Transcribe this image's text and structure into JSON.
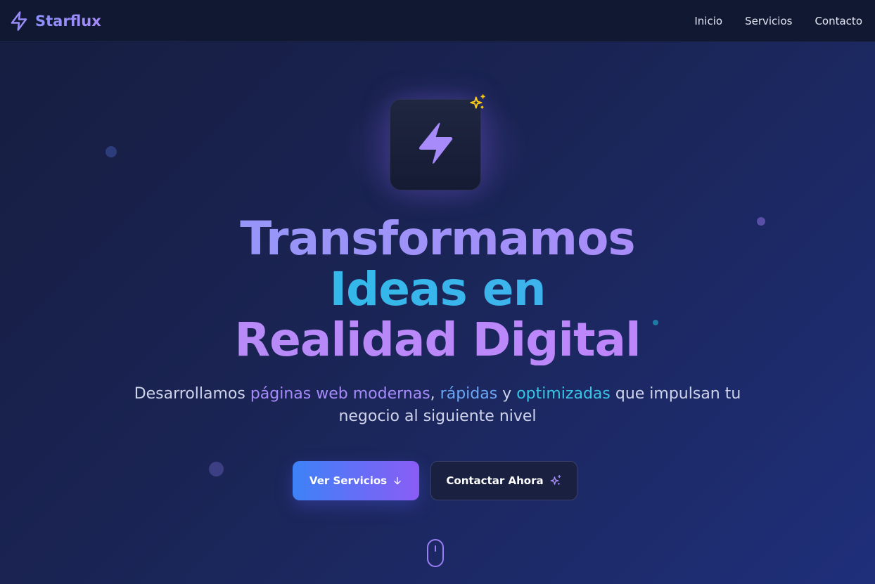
{
  "brand": {
    "name": "Starflux",
    "icon": "lightning-bolt-icon"
  },
  "nav": {
    "items": [
      {
        "label": "Inicio"
      },
      {
        "label": "Servicios"
      },
      {
        "label": "Contacto"
      }
    ]
  },
  "hero": {
    "logo_icon": "lightning-bolt-icon",
    "badge_icon": "sparkles-icon",
    "title_lines": [
      "Transformamos",
      "Ideas en",
      "Realidad Digital"
    ],
    "subtitle": {
      "part1": "Desarrollamos ",
      "highlight1": "páginas web modernas",
      "part2": ", ",
      "highlight2": "rápidas",
      "part3": " y ",
      "highlight3": "optimizadas",
      "part4": " que impulsan tu negocio al siguiente nivel"
    },
    "primary_button": {
      "label": "Ver Servicios",
      "icon": "arrow-down-icon"
    },
    "secondary_button": {
      "label": "Contactar Ahora",
      "icon": "sparkles-icon"
    },
    "scroll_icon": "mouse-scroll-icon"
  },
  "colors": {
    "accent_purple": "#a78bfa",
    "accent_blue": "#3d82f6",
    "accent_cyan": "#22c3e6",
    "badge_yellow": "#facc15",
    "background": "#1a2454"
  }
}
